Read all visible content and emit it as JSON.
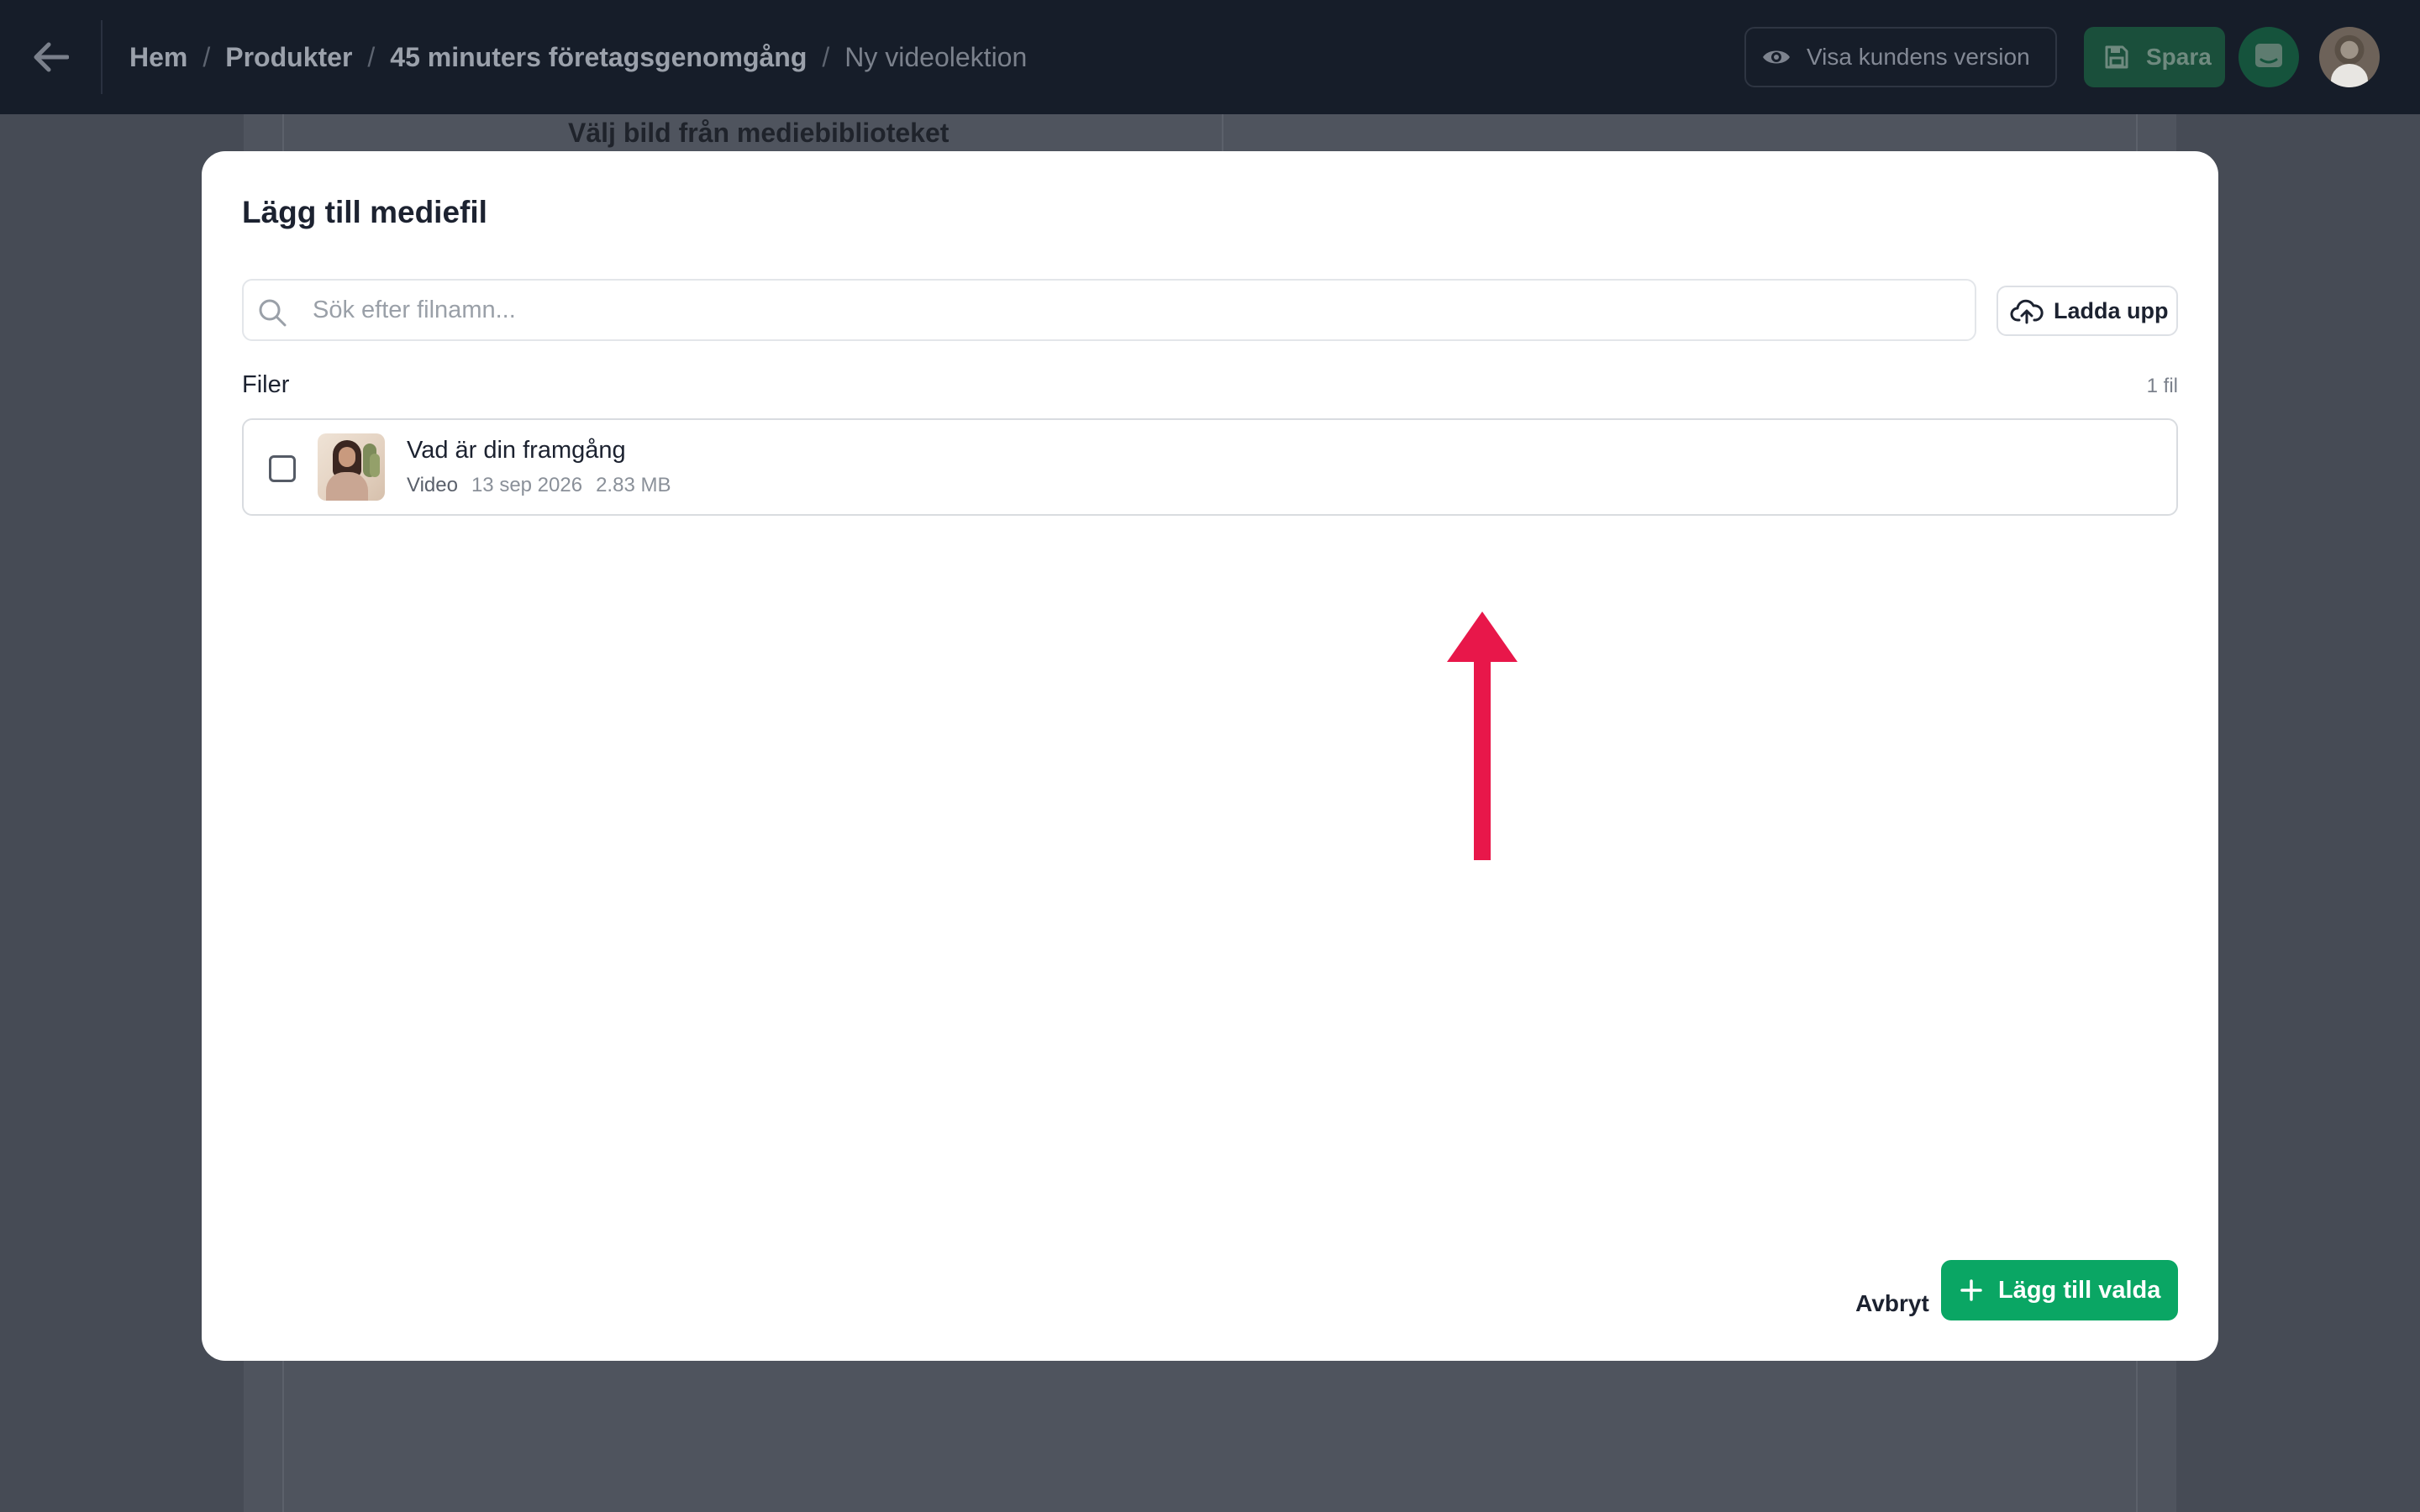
{
  "topbar": {
    "breadcrumb": [
      "Hem",
      "Produkter",
      "45 minuters företagsgenomgång",
      "Ny videolektion"
    ],
    "preview_label": "Visa kundens version",
    "save_label": "Spara"
  },
  "background": {
    "media_library_label": "Välj bild från mediebiblioteket"
  },
  "modal": {
    "title": "Lägg till mediefil",
    "search_placeholder": "Sök efter filnamn...",
    "upload_label": "Ladda upp",
    "files_label": "Filer",
    "files_count": "1 fil",
    "files": [
      {
        "name": "Vad är din framgång",
        "type": "Video",
        "date": "13 sep 2026",
        "size": "2.83 MB",
        "checked": false
      }
    ],
    "cancel_label": "Avbryt",
    "add_selected_label": "Lägg till valda"
  },
  "colors": {
    "accent_green": "#0aa664",
    "arrow_red": "#e8174a",
    "topbar_bg": "#161d29"
  }
}
